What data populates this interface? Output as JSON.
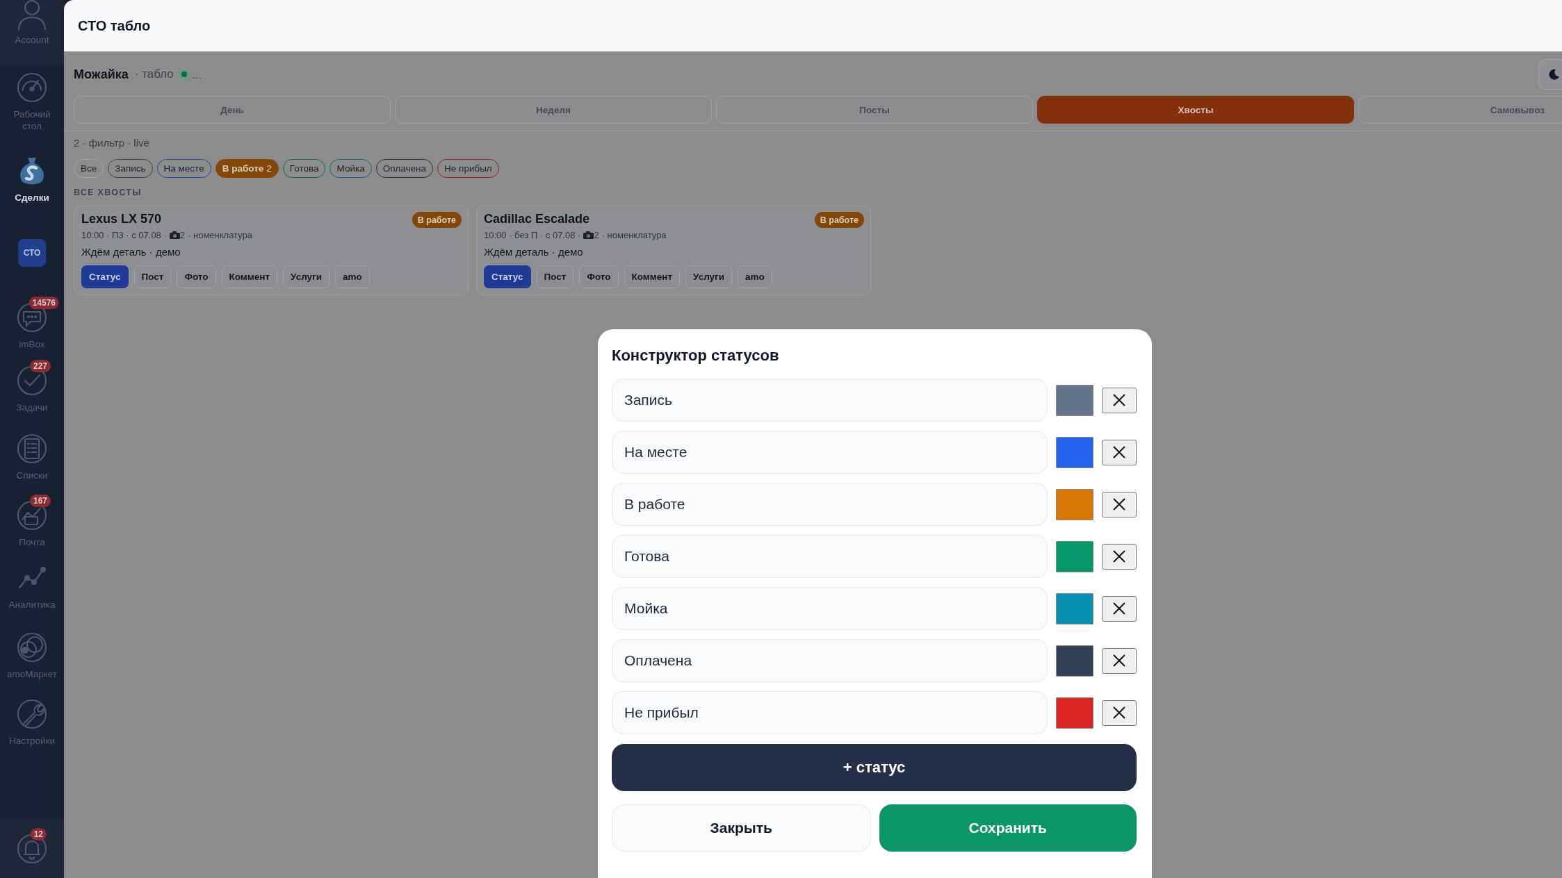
{
  "window": {
    "title": "СТО табло"
  },
  "sidebar": {
    "account": {
      "label": "Account"
    },
    "items": [
      {
        "kind": "nav",
        "label": "Рабочий стол",
        "selected": false
      },
      {
        "kind": "nav",
        "label": "Сделки",
        "selected": true
      },
      {
        "kind": "tile",
        "label": "СТО",
        "selected": false
      },
      {
        "kind": "nav",
        "label": "imBox",
        "selected": false,
        "badge": "14576"
      },
      {
        "kind": "nav",
        "label": "Задачи",
        "selected": false,
        "badge": "227"
      },
      {
        "kind": "nav",
        "label": "Списки",
        "selected": false
      },
      {
        "kind": "nav",
        "label": "Почта",
        "selected": false,
        "badge": "167"
      },
      {
        "kind": "nav",
        "label": "Аналитика",
        "selected": false
      },
      {
        "kind": "nav",
        "label": "amoМаркет",
        "selected": false
      },
      {
        "kind": "nav",
        "label": "Настройки",
        "selected": false
      }
    ],
    "notifications": {
      "badge": "12"
    }
  },
  "board": {
    "location": "Можайка",
    "subtitle": "· табло",
    "online": true,
    "status_text": "…"
  },
  "tabs": [
    {
      "label": "День",
      "selected": false
    },
    {
      "label": "Неделя",
      "selected": false
    },
    {
      "label": "Посты",
      "selected": false
    },
    {
      "label": "Хвосты",
      "selected": true
    },
    {
      "label": "Самовывоз",
      "selected": false
    }
  ],
  "filter_summary": "2 · фильтр · live",
  "chips": [
    {
      "label": "Все",
      "selected": false,
      "color": "#a3a4a8"
    },
    {
      "label": "Запись",
      "selected": false,
      "color": "#3e4655"
    },
    {
      "label": "На месте",
      "selected": false,
      "color": "#2449a6"
    },
    {
      "label": "В работе",
      "count": "2",
      "selected": true,
      "color": "#84470a"
    },
    {
      "label": "Готова",
      "selected": false,
      "color": "#0c6a4a"
    },
    {
      "label": "Мойка",
      "selected": false,
      "color": "#0c6a82"
    },
    {
      "label": "Оплачена",
      "selected": false,
      "color": "#262e3c"
    },
    {
      "label": "Не прибыл",
      "selected": false,
      "color": "#992222"
    }
  ],
  "section_title": "ВСЕ ХВОСТЫ",
  "cards": [
    {
      "title": "Lexus LX 570",
      "status": "В работе",
      "meta": "10:00 · П3 · с 07.08 ·",
      "photos": "2",
      "meta_tail": "· номенклатура",
      "note": "Ждём деталь · демо",
      "actions": [
        {
          "label": "Статус",
          "selected": true
        },
        {
          "label": "Пост",
          "selected": false
        },
        {
          "label": "Фото",
          "selected": false
        },
        {
          "label": "Коммент",
          "selected": false
        },
        {
          "label": "Услуги",
          "selected": false
        },
        {
          "label": "amo",
          "selected": false
        }
      ]
    },
    {
      "title": "Cadillac Escalade",
      "status": "В работе",
      "meta": "10:00 · без П · с 07.08 ·",
      "photos": "2",
      "meta_tail": "· номенклатура",
      "note": "Ждём деталь · демо",
      "actions": [
        {
          "label": "Статус",
          "selected": true
        },
        {
          "label": "Пост",
          "selected": false
        },
        {
          "label": "Фото",
          "selected": false
        },
        {
          "label": "Коммент",
          "selected": false
        },
        {
          "label": "Услуги",
          "selected": false
        },
        {
          "label": "amo",
          "selected": false
        }
      ]
    }
  ],
  "modal": {
    "title": "Конструктор статусов",
    "statuses": [
      {
        "name": "Запись",
        "color": "#64748b"
      },
      {
        "name": "На месте",
        "color": "#2563eb"
      },
      {
        "name": "В работе",
        "color": "#d97706"
      },
      {
        "name": "Готова",
        "color": "#059669"
      },
      {
        "name": "Мойка",
        "color": "#0891b2"
      },
      {
        "name": "Оплачена",
        "color": "#334155"
      },
      {
        "name": "Не прибыл",
        "color": "#dc2626"
      }
    ],
    "add_button": "+ статус",
    "close_button": "Закрыть",
    "save_button": "Сохранить"
  }
}
